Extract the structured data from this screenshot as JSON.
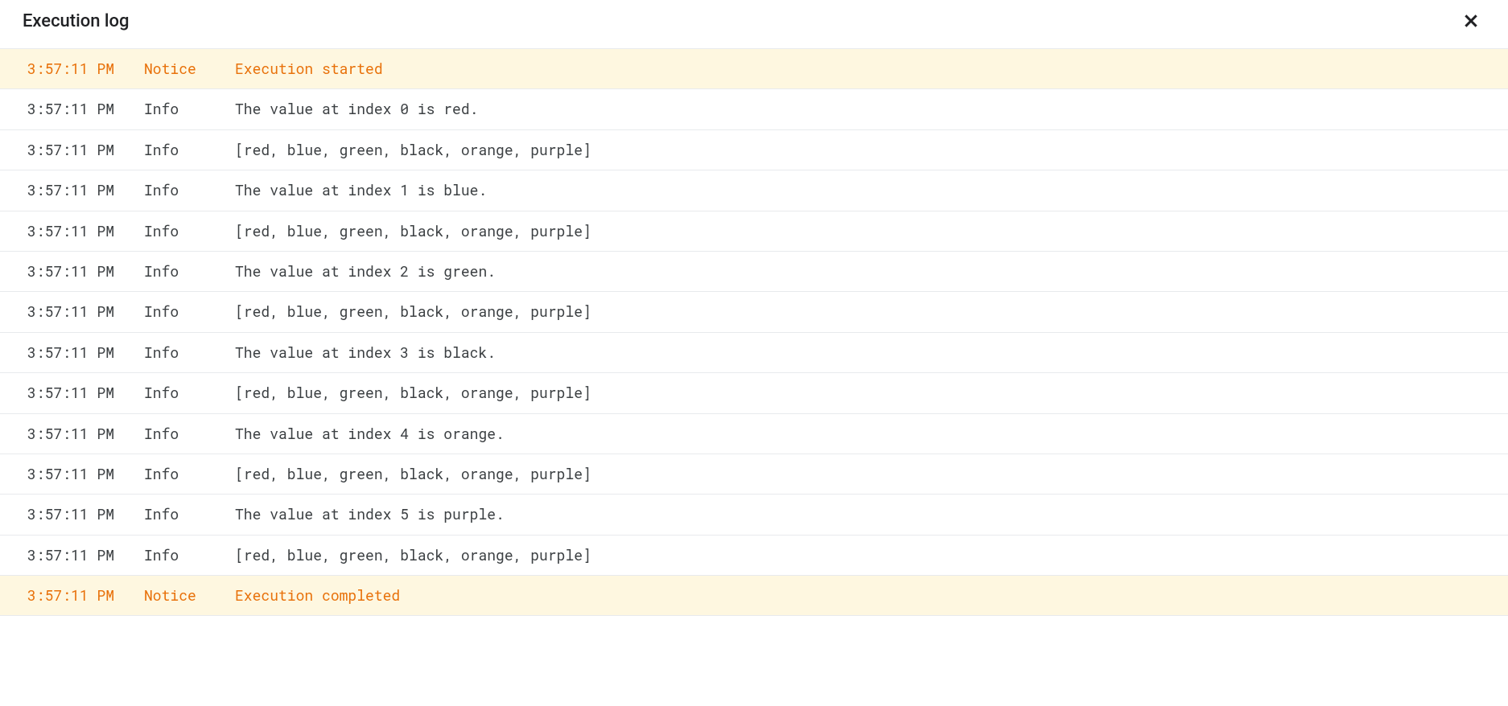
{
  "header": {
    "title": "Execution log"
  },
  "colors": {
    "notice_bg": "#fef7e0",
    "notice_fg": "#e8710a",
    "info_fg": "#3c4043",
    "divider": "#e8eaed"
  },
  "log": {
    "entries": [
      {
        "time": "3:57:11 PM",
        "level": "Notice",
        "message": "Execution started",
        "kind": "notice"
      },
      {
        "time": "3:57:11 PM",
        "level": "Info",
        "message": "The value at index 0 is red.",
        "kind": "info"
      },
      {
        "time": "3:57:11 PM",
        "level": "Info",
        "message": "[red, blue, green, black, orange, purple]",
        "kind": "info"
      },
      {
        "time": "3:57:11 PM",
        "level": "Info",
        "message": "The value at index 1 is blue.",
        "kind": "info"
      },
      {
        "time": "3:57:11 PM",
        "level": "Info",
        "message": "[red, blue, green, black, orange, purple]",
        "kind": "info"
      },
      {
        "time": "3:57:11 PM",
        "level": "Info",
        "message": "The value at index 2 is green.",
        "kind": "info"
      },
      {
        "time": "3:57:11 PM",
        "level": "Info",
        "message": "[red, blue, green, black, orange, purple]",
        "kind": "info"
      },
      {
        "time": "3:57:11 PM",
        "level": "Info",
        "message": "The value at index 3 is black.",
        "kind": "info"
      },
      {
        "time": "3:57:11 PM",
        "level": "Info",
        "message": "[red, blue, green, black, orange, purple]",
        "kind": "info"
      },
      {
        "time": "3:57:11 PM",
        "level": "Info",
        "message": "The value at index 4 is orange.",
        "kind": "info"
      },
      {
        "time": "3:57:11 PM",
        "level": "Info",
        "message": "[red, blue, green, black, orange, purple]",
        "kind": "info"
      },
      {
        "time": "3:57:11 PM",
        "level": "Info",
        "message": "The value at index 5 is purple.",
        "kind": "info"
      },
      {
        "time": "3:57:11 PM",
        "level": "Info",
        "message": "[red, blue, green, black, orange, purple]",
        "kind": "info"
      },
      {
        "time": "3:57:11 PM",
        "level": "Notice",
        "message": "Execution completed",
        "kind": "notice"
      }
    ]
  }
}
